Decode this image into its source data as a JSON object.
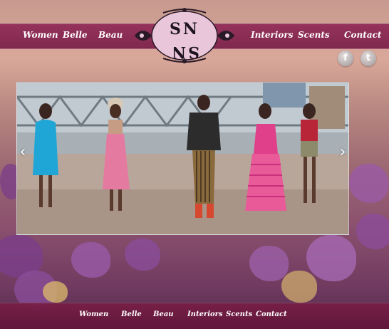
{
  "nav": {
    "left": [
      "Women",
      "Belle",
      "Beau"
    ],
    "right": [
      "Interiors",
      "Scents",
      "Contact"
    ]
  },
  "logo": {
    "text_top": "SN",
    "text_bottom": "SN"
  },
  "social": {
    "facebook": "f",
    "twitter": "t"
  },
  "slider": {
    "prev_glyph": "‹",
    "next_glyph": "›"
  },
  "footer_nav": [
    "Women",
    "Belle",
    "Beau",
    "Interiors",
    "Scents",
    "Contact"
  ],
  "colors": {
    "nav_bar": "#8f2855",
    "footer_bar": "#6e1e48",
    "accent_pink": "#e07aa6"
  }
}
